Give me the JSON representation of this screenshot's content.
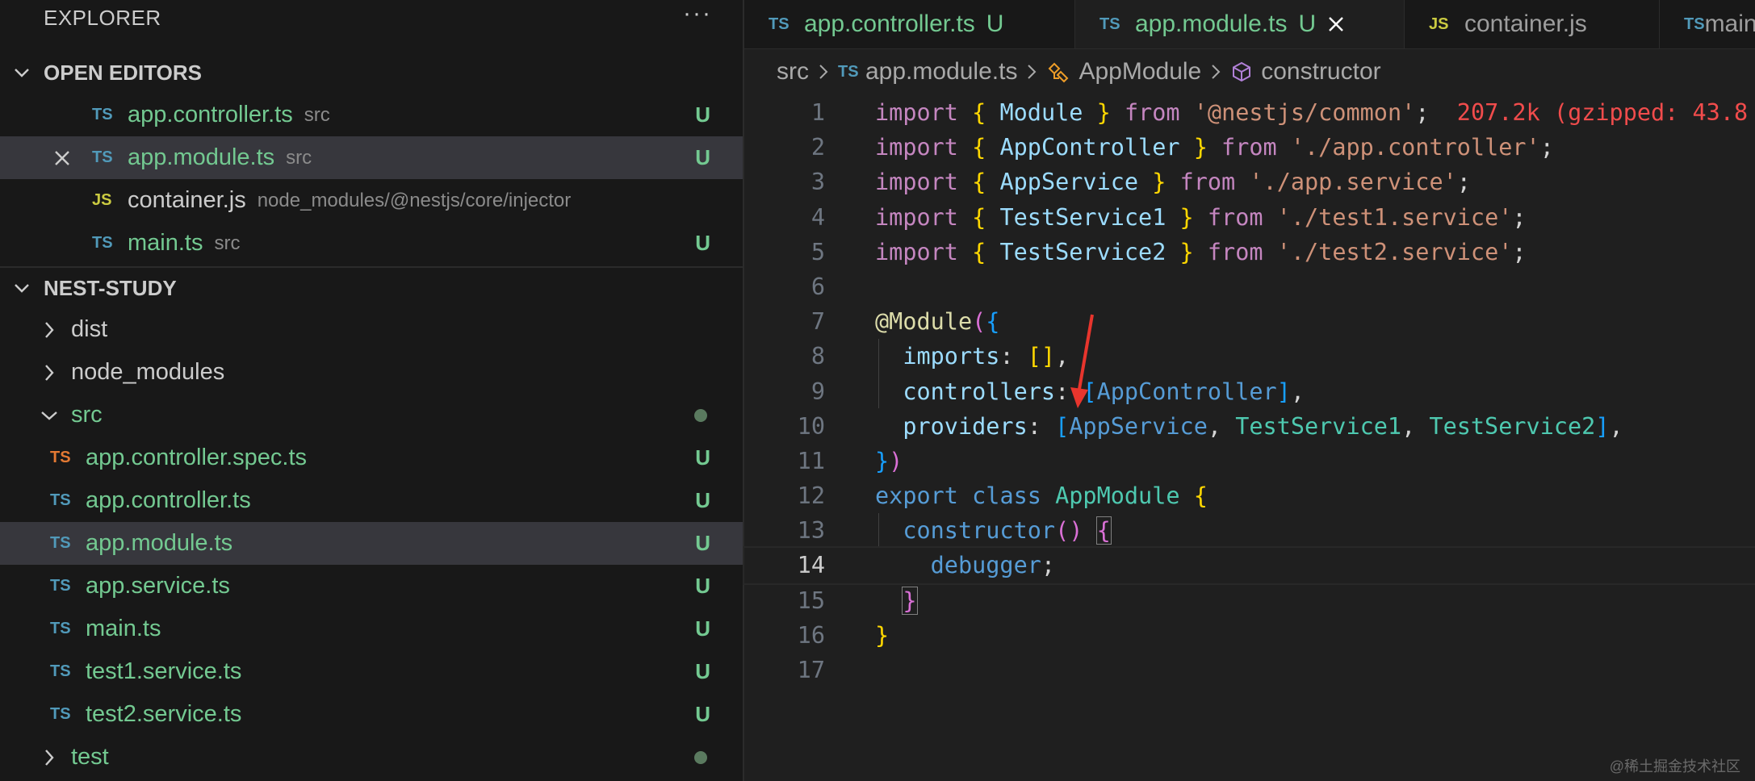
{
  "explorer": {
    "title": "EXPLORER",
    "more": "···",
    "open_editors": {
      "title": "OPEN EDITORS",
      "items": [
        {
          "icon": "TS",
          "name": "app.controller.ts",
          "dir": "src",
          "status": "U"
        },
        {
          "icon": "TS",
          "name": "app.module.ts",
          "dir": "src",
          "status": "U"
        },
        {
          "icon": "JS",
          "name": "container.js",
          "dir": "node_modules/@nestjs/core/injector",
          "status": ""
        },
        {
          "icon": "TS",
          "name": "main.ts",
          "dir": "src",
          "status": "U"
        }
      ]
    },
    "project": {
      "title": "NEST-STUDY",
      "folders": {
        "dist": "dist",
        "node_modules": "node_modules",
        "src": "src",
        "test": "test"
      },
      "src_files": [
        {
          "icon": "TS",
          "name": "app.controller.spec.ts",
          "status": "U"
        },
        {
          "icon": "TS",
          "name": "app.controller.ts",
          "status": "U"
        },
        {
          "icon": "TS",
          "name": "app.module.ts",
          "status": "U"
        },
        {
          "icon": "TS",
          "name": "app.service.ts",
          "status": "U"
        },
        {
          "icon": "TS",
          "name": "main.ts",
          "status": "U"
        },
        {
          "icon": "TS",
          "name": "test1.service.ts",
          "status": "U"
        },
        {
          "icon": "TS",
          "name": "test2.service.ts",
          "status": "U"
        }
      ]
    }
  },
  "tabs": [
    {
      "icon": "TS",
      "name": "app.controller.ts",
      "mod": "U"
    },
    {
      "icon": "TS",
      "name": "app.module.ts",
      "mod": "U"
    },
    {
      "icon": "JS",
      "name": "container.js",
      "mod": ""
    },
    {
      "icon": "TS",
      "name": "main.ts",
      "mod": ""
    }
  ],
  "breadcrumb": {
    "folder": "src",
    "icon": "TS",
    "file": "app.module.ts",
    "class": "AppModule",
    "method": "constructor"
  },
  "editor": {
    "current_line": 14,
    "line_numbers": [
      "1",
      "2",
      "3",
      "4",
      "5",
      "6",
      "7",
      "8",
      "9",
      "10",
      "11",
      "12",
      "13",
      "14",
      "15",
      "16",
      "17"
    ],
    "import_cost": "207.2k (gzipped: 43.8",
    "code": {
      "import": "import",
      "from": "from",
      "Module": "Module",
      "AppController": "AppController",
      "AppService": "AppService",
      "TestService1": "TestService1",
      "TestService2": "TestService2",
      "src_common": "'@nestjs/common'",
      "src_controller": "'./app.controller'",
      "src_service": "'./app.service'",
      "src_test1": "'./test1.service'",
      "src_test2": "'./test2.service'",
      "decorator": "@Module",
      "imports_key": "imports",
      "controllers_key": "controllers",
      "providers_key": "providers",
      "export": "export",
      "class": "class",
      "AppModule": "AppModule",
      "constructor": "constructor",
      "debugger": "debugger"
    }
  },
  "watermark": "@稀土掘金技术社区"
}
